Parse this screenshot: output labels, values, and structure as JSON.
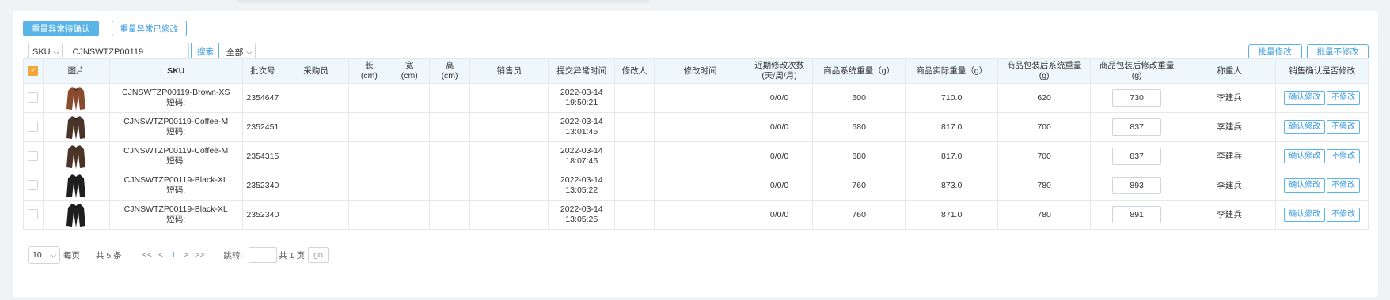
{
  "tabs": [
    {
      "label": "重量异常待确认",
      "active": true
    },
    {
      "label": "重量异常已修改",
      "active": false
    }
  ],
  "filters": {
    "field_select": "SKU",
    "search_value": "CJNSWTZP00119",
    "search_label": "搜索",
    "status_select": "全部"
  },
  "batch": {
    "modify_label": "批量修改",
    "no_modify_label": "批量不修改"
  },
  "table": {
    "headers": {
      "image": "图片",
      "sku": "SKU",
      "batch": "批次号",
      "buyer": "采购员",
      "length": "长",
      "width": "宽",
      "height": "高",
      "unit": "(cm)",
      "seller": "销售员",
      "submit_time": "提交异常时间",
      "modifier": "修改人",
      "modify_time": "修改时间",
      "recent_mod": "近期修改次数",
      "recent_mod_sub": "(天/周/月)",
      "sys_weight": "商品系统重量（g）",
      "actual_weight": "商品实际重量（g）",
      "pkg_sys_weight": "商品包装后系统重量",
      "pkg_mod_weight": "商品包装后修改重量",
      "g_unit": "(g)",
      "weigher": "称重人",
      "confirm": "销售确认是否修改"
    },
    "rows": [
      {
        "sku": "CJNSWTZP00119-Brown-XS",
        "short": "短码:",
        "batch": "2354647",
        "date": "2022-03-14",
        "time": "19:50:21",
        "recent": "0/0/0",
        "sys_w": "600",
        "act_w": "710.0",
        "pkg_sys": "620",
        "pkg_mod": "730",
        "weigher": "李建兵",
        "color": "#8a4a2e"
      },
      {
        "sku": "CJNSWTZP00119-Coffee-M",
        "short": "短码:",
        "batch": "2352451",
        "date": "2022-03-14",
        "time": "13:01:45",
        "recent": "0/0/0",
        "sys_w": "680",
        "act_w": "817.0",
        "pkg_sys": "700",
        "pkg_mod": "837",
        "weigher": "李建兵",
        "color": "#4a3327"
      },
      {
        "sku": "CJNSWTZP00119-Coffee-M",
        "short": "短码:",
        "batch": "2354315",
        "date": "2022-03-14",
        "time": "18:07:46",
        "recent": "0/0/0",
        "sys_w": "680",
        "act_w": "817.0",
        "pkg_sys": "700",
        "pkg_mod": "837",
        "weigher": "李建兵",
        "color": "#4a3327"
      },
      {
        "sku": "CJNSWTZP00119-Black-XL",
        "short": "短码:",
        "batch": "2352340",
        "date": "2022-03-14",
        "time": "13:05:22",
        "recent": "0/0/0",
        "sys_w": "760",
        "act_w": "873.0",
        "pkg_sys": "780",
        "pkg_mod": "893",
        "weigher": "李建兵",
        "color": "#1e1e1e"
      },
      {
        "sku": "CJNSWTZP00119-Black-XL",
        "short": "短码:",
        "batch": "2352340",
        "date": "2022-03-14",
        "time": "13:05:25",
        "recent": "0/0/0",
        "sys_w": "760",
        "act_w": "871.0",
        "pkg_sys": "780",
        "pkg_mod": "891",
        "weigher": "李建兵",
        "color": "#1e1e1e"
      }
    ],
    "confirm_label": "确认修改",
    "reject_label": "不修改"
  },
  "pager": {
    "page_size": "10",
    "per_page_label": "每页",
    "total_label": "共 5 条",
    "first": "<<",
    "prev": "<",
    "current": "1",
    "next": ">",
    "last": ">>",
    "jump_label": "跳转:",
    "total_pages_label": "共 1 页",
    "go_label": "go"
  }
}
